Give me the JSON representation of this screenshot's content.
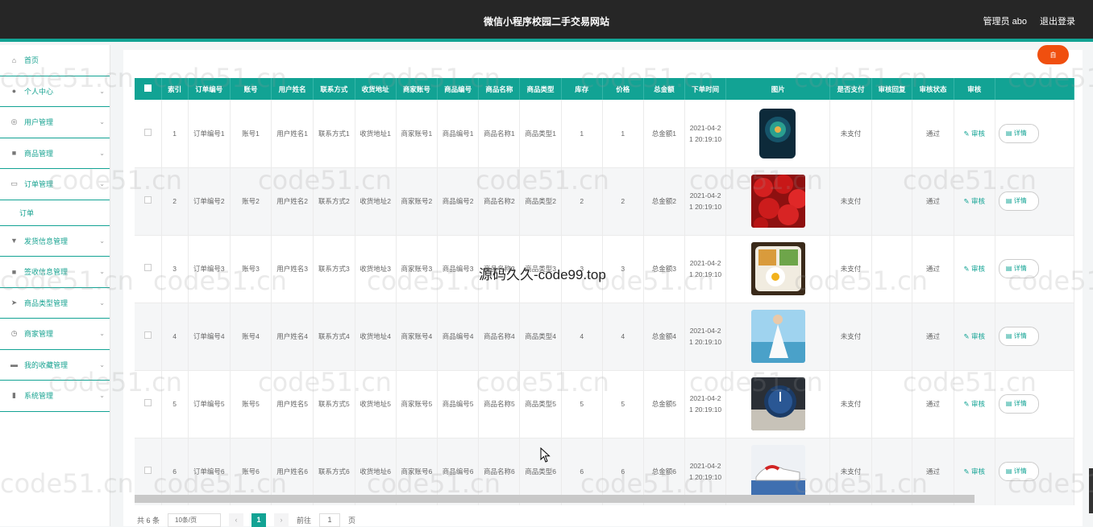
{
  "header": {
    "title": "微信小程序校园二手交易网站",
    "user": "管理员 abo",
    "logout": "退出登录"
  },
  "sidebar": {
    "items": [
      {
        "label": "首页",
        "icon": "home-icon",
        "glyph": "⌂",
        "chevron": false
      },
      {
        "label": "个人中心",
        "icon": "user-icon",
        "glyph": "●",
        "chevron": true
      },
      {
        "label": "用户管理",
        "icon": "gauge-icon",
        "glyph": "◎",
        "chevron": true
      },
      {
        "label": "商品管理",
        "icon": "briefcase-icon",
        "glyph": "■",
        "chevron": true
      },
      {
        "label": "订单管理",
        "icon": "monitor-icon",
        "glyph": "▭",
        "chevron": true
      },
      {
        "label": "发货信息管理",
        "icon": "trophy-icon",
        "glyph": "▼",
        "chevron": true
      },
      {
        "label": "签收信息管理",
        "icon": "desktop-icon",
        "glyph": "■",
        "chevron": true
      },
      {
        "label": "商品类型管理",
        "icon": "send-icon",
        "glyph": "➤",
        "chevron": true
      },
      {
        "label": "商家管理",
        "icon": "clock-icon",
        "glyph": "◷",
        "chevron": true
      },
      {
        "label": "我的收藏管理",
        "icon": "card-icon",
        "glyph": "▬",
        "chevron": true
      },
      {
        "label": "系统管理",
        "icon": "chart-icon",
        "glyph": "▮",
        "chevron": true
      }
    ],
    "submenu": "订单"
  },
  "float_button": "自",
  "table": {
    "columns": [
      "索引",
      "订单编号",
      "账号",
      "用户姓名",
      "联系方式",
      "收货地址",
      "商家账号",
      "商品编号",
      "商品名称",
      "商品类型",
      "库存",
      "价格",
      "总金额",
      "下单时间",
      "图片",
      "是否支付",
      "审核回复",
      "审核状态",
      "审核"
    ],
    "rows": [
      {
        "index": "1",
        "order_no": "订单编号1",
        "account": "账号1",
        "name": "用户姓名1",
        "contact": "联系方式1",
        "address": "收货地址1",
        "merchant": "商家账号1",
        "goods_no": "商品编号1",
        "goods_name": "商品名称1",
        "goods_type": "商品类型1",
        "stock": "1",
        "price": "1",
        "total": "总金额1",
        "time": "2021-04-21 20:19:10",
        "picture": "phone",
        "paid": "未支付",
        "reply": "",
        "status": "通过",
        "audit": "审核",
        "detail": "详情"
      },
      {
        "index": "2",
        "order_no": "订单编号2",
        "account": "账号2",
        "name": "用户姓名2",
        "contact": "联系方式2",
        "address": "收货地址2",
        "merchant": "商家账号2",
        "goods_no": "商品编号2",
        "goods_name": "商品名称2",
        "goods_type": "商品类型2",
        "stock": "2",
        "price": "2",
        "total": "总金额2",
        "time": "2021-04-21 20:19:10",
        "picture": "cherries",
        "paid": "未支付",
        "reply": "",
        "status": "通过",
        "audit": "审核",
        "detail": "详情"
      },
      {
        "index": "3",
        "order_no": "订单编号3",
        "account": "账号3",
        "name": "用户姓名3",
        "contact": "联系方式3",
        "address": "收货地址3",
        "merchant": "商家账号3",
        "goods_no": "商品编号3",
        "goods_name": "商品名称3",
        "goods_type": "商品类型3",
        "stock": "3",
        "price": "3",
        "total": "总金额3",
        "time": "2021-04-21 20:19:10",
        "picture": "bento",
        "paid": "未支付",
        "reply": "",
        "status": "通过",
        "audit": "审核",
        "detail": "详情"
      },
      {
        "index": "4",
        "order_no": "订单编号4",
        "account": "账号4",
        "name": "用户姓名4",
        "contact": "联系方式4",
        "address": "收货地址4",
        "merchant": "商家账号4",
        "goods_no": "商品编号4",
        "goods_name": "商品名称4",
        "goods_type": "商品类型4",
        "stock": "4",
        "price": "4",
        "total": "总金额4",
        "time": "2021-04-21 20:19:10",
        "picture": "dress",
        "paid": "未支付",
        "reply": "",
        "status": "通过",
        "audit": "审核",
        "detail": "详情"
      },
      {
        "index": "5",
        "order_no": "订单编号5",
        "account": "账号5",
        "name": "用户姓名5",
        "contact": "联系方式5",
        "address": "收货地址5",
        "merchant": "商家账号5",
        "goods_no": "商品编号5",
        "goods_name": "商品名称5",
        "goods_type": "商品类型5",
        "stock": "5",
        "price": "5",
        "total": "总金额5",
        "time": "2021-04-21 20:19:10",
        "picture": "watch",
        "paid": "未支付",
        "reply": "",
        "status": "通过",
        "audit": "审核",
        "detail": "详情"
      },
      {
        "index": "6",
        "order_no": "订单编号6",
        "account": "账号6",
        "name": "用户姓名6",
        "contact": "联系方式6",
        "address": "收货地址6",
        "merchant": "商家账号6",
        "goods_no": "商品编号6",
        "goods_name": "商品名称6",
        "goods_type": "商品类型6",
        "stock": "6",
        "price": "6",
        "total": "总金额6",
        "time": "2021-04-21 20:19:10",
        "picture": "sneakers",
        "paid": "未支付",
        "reply": "",
        "status": "通过",
        "audit": "审核",
        "detail": "详情"
      }
    ]
  },
  "pagination": {
    "total": "共 6 条",
    "page_size": "10条/页",
    "prev": "‹",
    "current": "1",
    "next": "›",
    "goto_label": "前往",
    "goto_value": "1",
    "page_suffix": "页"
  },
  "watermark": {
    "text": "code51.cn",
    "center": "源码久久-code99.top"
  },
  "colors": {
    "accent": "#12a394",
    "header_bg": "#262626",
    "float_button": "#f04f0f"
  }
}
